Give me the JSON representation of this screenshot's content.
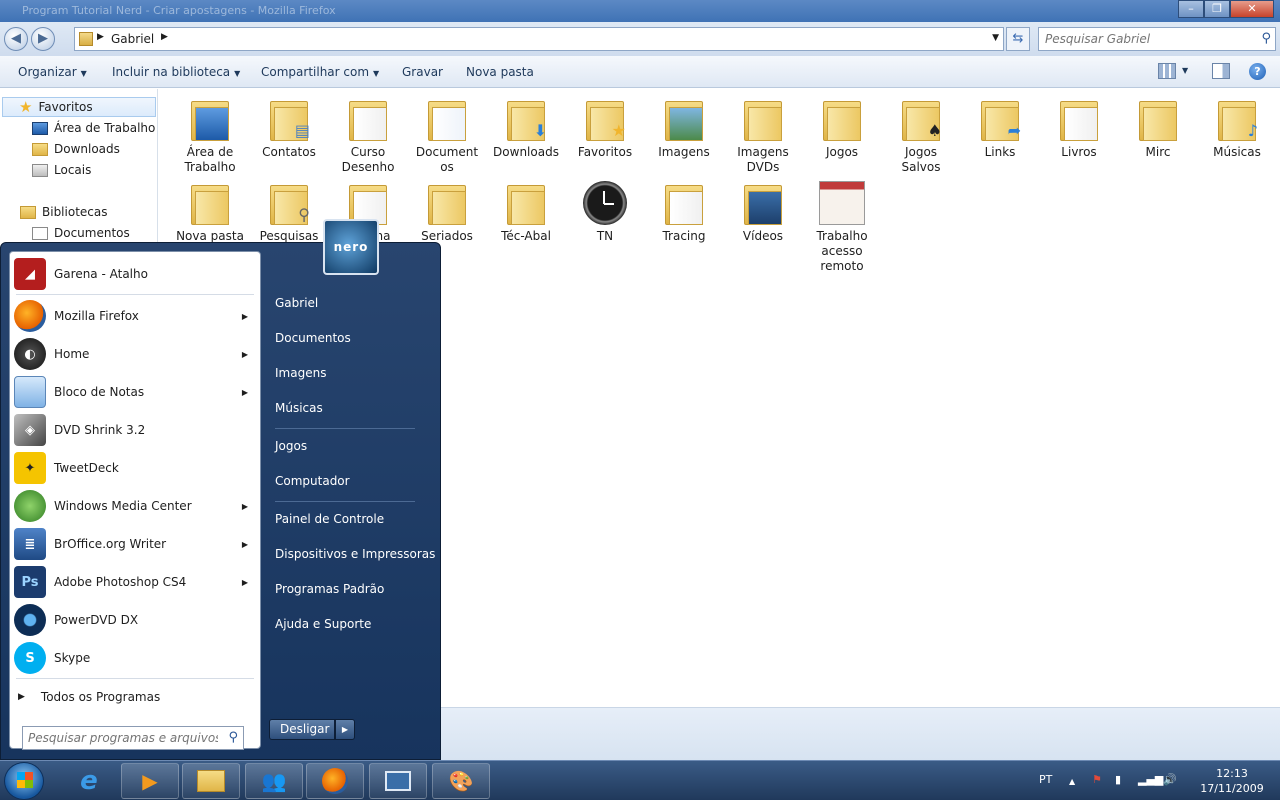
{
  "window": {
    "title": "Program Tutorial Nerd - Criar apostagens - Mozilla Firefox"
  },
  "address": {
    "crumb": "Gabriel"
  },
  "search": {
    "placeholder": "Pesquisar Gabriel"
  },
  "commands": {
    "organize": "Organizar",
    "include_library": "Incluir na biblioteca",
    "share": "Compartilhar com",
    "burn": "Gravar",
    "new_folder": "Nova pasta"
  },
  "nav": {
    "favorites": "Favoritos",
    "items": [
      "Área de Trabalho",
      "Downloads",
      "Locais"
    ],
    "libraries": "Bibliotecas",
    "documents": "Documentos"
  },
  "folders": {
    "row1": [
      "Área de Trabalho",
      "Contatos",
      "Curso Desenho",
      "Documentos",
      "Downloads",
      "Favoritos",
      "Imagens",
      "Imagens DVDs",
      "Jogos",
      "Jogos Salvos",
      "Links",
      "Livros",
      "Mirc",
      "Músicas"
    ],
    "row2": [
      "Nova pasta",
      "Pesquisas",
      "na",
      "Seriados",
      "Téc-Abal",
      "TN",
      "Tracing",
      "Vídeos",
      "Trabalho acesso remoto"
    ]
  },
  "folder_labels_display": {
    "r1_0": "Área de\nTrabalho",
    "r1_3": "Document\nos",
    "r1_2": "Curso\nDesenho",
    "r1_7": "Imagens\nDVDs",
    "r1_9": "Jogos\nSalvos",
    "r2_8": "Trabalho\nacesso\nremoto"
  },
  "start_menu": {
    "programs": [
      {
        "label": "Garena - Atalho",
        "icon": "garena-icon",
        "color": "#b41e1e",
        "arrow": false
      },
      {
        "label": "Mozilla Firefox",
        "icon": "firefox-icon",
        "color": "#e66000",
        "arrow": true
      },
      {
        "label": "Home",
        "icon": "home-icon",
        "color": "#222222",
        "arrow": true
      },
      {
        "label": "Bloco de Notas",
        "icon": "notepad-icon",
        "color": "#7fb2e5",
        "arrow": true
      },
      {
        "label": "DVD Shrink 3.2",
        "icon": "dvd-shrink-icon",
        "color": "#555555",
        "arrow": false
      },
      {
        "label": "TweetDeck",
        "icon": "tweetdeck-icon",
        "color": "#f5c400",
        "arrow": false
      },
      {
        "label": "Windows Media Center",
        "icon": "media-center-icon",
        "color": "#3f9e2f",
        "arrow": true
      },
      {
        "label": "BrOffice.org Writer",
        "icon": "writer-icon",
        "color": "#2a5b9e",
        "arrow": true
      },
      {
        "label": "Adobe Photoshop CS4",
        "icon": "photoshop-icon",
        "color": "#1c3c6e",
        "arrow": true
      },
      {
        "label": "PowerDVD DX",
        "icon": "powerdvd-icon",
        "color": "#0d2d55",
        "arrow": false
      },
      {
        "label": "Skype",
        "icon": "skype-icon",
        "color": "#00aff0",
        "arrow": false
      }
    ],
    "ps_text": "Ps",
    "all_programs": "Todos os Programas",
    "search_placeholder": "Pesquisar programas e arquivos",
    "avatar_text": "nero",
    "right": {
      "group1": [
        "Gabriel",
        "Documentos",
        "Imagens",
        "Músicas"
      ],
      "group2": [
        "Jogos",
        "Computador"
      ],
      "group3": [
        "Painel de Controle",
        "Dispositivos e Impressoras",
        "Programas Padrão",
        "Ajuda e Suporte"
      ]
    },
    "shutdown": "Desligar"
  },
  "taskbar": {
    "language": "PT",
    "time": "12:13",
    "date": "17/11/2009"
  }
}
